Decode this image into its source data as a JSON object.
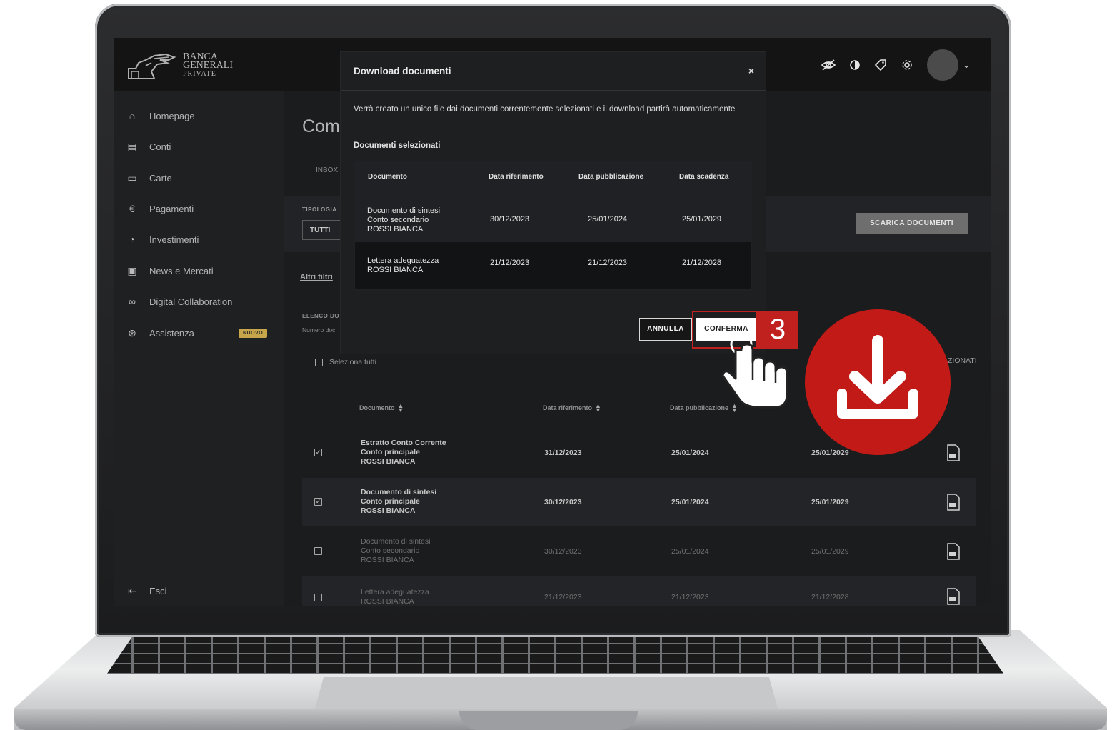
{
  "brand": {
    "line1": "BANCA",
    "line2": "GENERALI",
    "line3": "PRIVATE"
  },
  "header_icons": [
    "eye-off-icon",
    "contrast-icon",
    "tag-icon",
    "gear-icon"
  ],
  "sidebar": {
    "items": [
      {
        "label": "Homepage",
        "icon": "home-icon"
      },
      {
        "label": "Conti",
        "icon": "database-icon"
      },
      {
        "label": "Carte",
        "icon": "card-icon"
      },
      {
        "label": "Pagamenti",
        "icon": "euro-icon"
      },
      {
        "label": "Investimenti",
        "icon": "pie-icon"
      },
      {
        "label": "News e Mercati",
        "icon": "news-icon"
      },
      {
        "label": "Digital Collaboration",
        "icon": "handshake-icon"
      },
      {
        "label": "Assistenza",
        "icon": "lifebuoy-icon"
      }
    ],
    "badge": "NUOVO",
    "logout": "Esci"
  },
  "main": {
    "title_partial": "Com",
    "tab_inbox": "INBOX",
    "tipologia_label": "TIPOLOGIA",
    "tipologia_value": "TUTTI",
    "download_button": "SCARICA DOCUMENTI",
    "altri_filtri": "Altri filtri",
    "elenco_label": "ELENCO DO",
    "numero_label": "Numero doc",
    "select_all": "Seleziona tutti",
    "selezionati_partial": "ZIONATI",
    "columns": [
      "Documento",
      "Data riferimento",
      "Data pubblicazione"
    ],
    "rows": [
      {
        "doc": [
          "Estratto Conto Corrente",
          "Conto principale",
          "ROSSI BIANCA"
        ],
        "rif": "31/12/2023",
        "pub": "25/01/2024",
        "sca": "25/01/2029",
        "checked": true
      },
      {
        "doc": [
          "Documento di sintesi",
          "Conto principale",
          "ROSSI BIANCA"
        ],
        "rif": "30/12/2023",
        "pub": "25/01/2024",
        "sca": "25/01/2029",
        "checked": true
      },
      {
        "doc": [
          "Documento di sintesi",
          "Conto secondario",
          "ROSSI BIANCA"
        ],
        "rif": "30/12/2023",
        "pub": "25/01/2024",
        "sca": "25/01/2029",
        "checked": false
      },
      {
        "doc": [
          "Lettera adeguatezza",
          "ROSSI BIANCA"
        ],
        "rif": "21/12/2023",
        "pub": "21/12/2023",
        "sca": "21/12/2028",
        "checked": false
      }
    ]
  },
  "modal": {
    "title": "Download documenti",
    "close": "×",
    "description": "Verrà creato un unico file dai documenti correntemente selezionati e il download partirà automaticamente",
    "subtitle": "Documenti selezionati",
    "columns": [
      "Documento",
      "Data riferimento",
      "Data pubblicazione",
      "Data scadenza"
    ],
    "rows": [
      {
        "doc": [
          "Documento di sintesi",
          "Conto secondario",
          "ROSSI BIANCA"
        ],
        "rif": "30/12/2023",
        "pub": "25/01/2024",
        "sca": "25/01/2029"
      },
      {
        "doc": [
          "Lettera adeguatezza",
          "ROSSI BIANCA"
        ],
        "rif": "21/12/2023",
        "pub": "21/12/2023",
        "sca": "21/12/2028"
      }
    ],
    "cancel": "ANNULLA",
    "confirm": "CONFERMA"
  },
  "step_number": "3",
  "accent_color": "#c0211f"
}
